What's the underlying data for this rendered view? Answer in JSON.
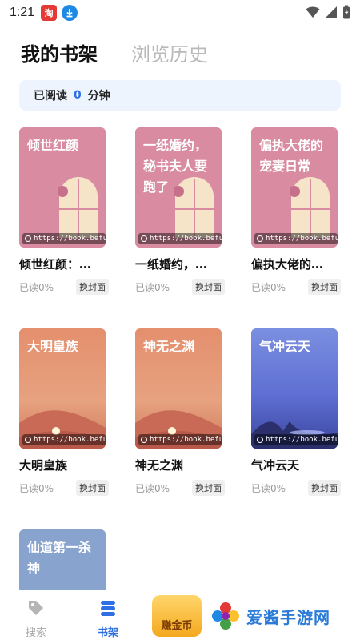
{
  "status_bar": {
    "time": "1:21",
    "app_badge": "淘"
  },
  "tabs": {
    "active": "我的书架",
    "inactive": "浏览历史"
  },
  "reading": {
    "prefix": "已阅读",
    "minutes": "0",
    "suffix": "分钟"
  },
  "books": [
    {
      "cover_title": "倾世红颜",
      "url": "https://book.befu",
      "name": "倾世红颜：…",
      "progress": "已读0%",
      "swap": "换封面"
    },
    {
      "cover_title": "一纸婚约，秘书夫人要跑了",
      "url": "https://book.befu",
      "name": "一纸婚约，…",
      "progress": "已读0%",
      "swap": "换封面"
    },
    {
      "cover_title": "偏执大佬的宠妻日常",
      "url": "https://book.befu",
      "name": "偏执大佬的…",
      "progress": "已读0%",
      "swap": "换封面"
    },
    {
      "cover_title": "大明皇族",
      "url": "https://book.befu",
      "name": "大明皇族",
      "progress": "已读0%",
      "swap": "换封面"
    },
    {
      "cover_title": "神无之渊",
      "url": "https://book.befu",
      "name": "神无之渊",
      "progress": "已读0%",
      "swap": "换封面"
    },
    {
      "cover_title": "气冲云天",
      "url": "https://book.befu",
      "name": "气冲云天",
      "progress": "已读0%",
      "swap": "换封面"
    },
    {
      "cover_title": "仙道第一杀神",
      "url": "",
      "name": "",
      "progress": "",
      "swap": ""
    }
  ],
  "bottom_nav": {
    "search": "搜索",
    "shelf": "书架",
    "coin": "赚金币"
  },
  "watermark": {
    "text": "爱酱手游网"
  },
  "colors": {
    "accent": "#2f6fe4",
    "pink_cover": "#d98ba2",
    "banner_bg": "#eef4fd"
  }
}
